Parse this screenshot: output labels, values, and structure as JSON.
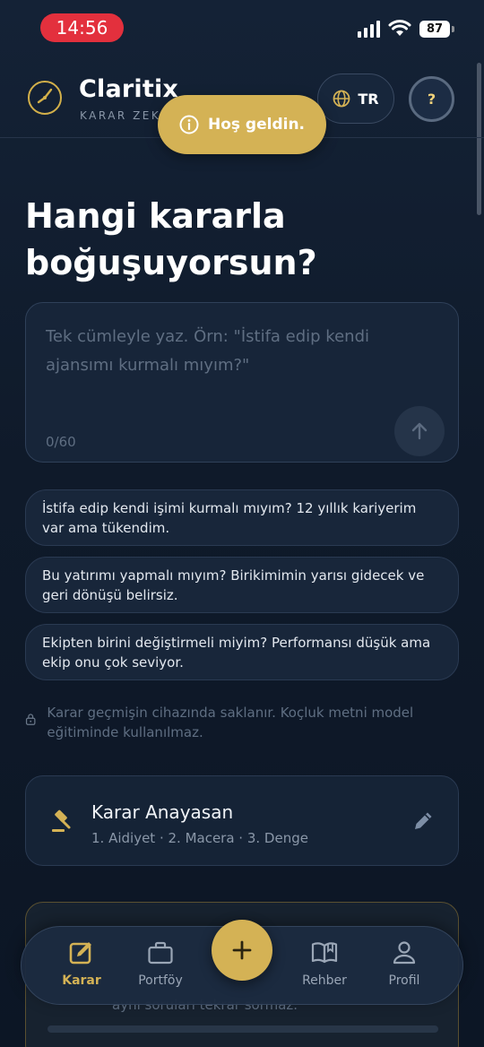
{
  "status_bar": {
    "time": "14:56",
    "battery": "87"
  },
  "header": {
    "app_name": "Claritix",
    "tagline": "KARAR ZEKÂ",
    "language": "TR",
    "help_label": "?"
  },
  "toast": {
    "message": "Hoş geldin."
  },
  "main": {
    "title_line1": "Hangi kararla",
    "title_line2": "boğuşuyorsun?",
    "input_placeholder": "Tek cümleyle yaz. Örn: \"İstifa edip kendi ajansımı kurmalı mıyım?\"",
    "input_value": "",
    "char_count": "0/60",
    "suggestions": [
      "İstifa edip kendi işimi kurmalı mıyım? 12 yıllık kariyerim var ama tükendim.",
      "Bu yatırımı yapmalı mıyım? Birikimimin yarısı gidecek ve geri dönüşü belirsiz.",
      "Ekipten birini değiştirmeli miyim? Performansı düşük ama ekip onu çok seviyor."
    ],
    "privacy_note": "Karar geçmişin cihazında saklanır. Koçluk metni model eğitiminde kullanılmaz."
  },
  "constitution": {
    "title": "Karar Anayasan",
    "values": "1. Aidiyet · 2. Macera · 3. Denge"
  },
  "partial_card": {
    "text": "aynı soruları tekrar sormaz."
  },
  "nav": {
    "items": [
      {
        "label": "Karar",
        "icon": "edit-square-icon",
        "active": true
      },
      {
        "label": "Portföy",
        "icon": "briefcase-icon",
        "active": false
      },
      {
        "label": "Rehber",
        "icon": "open-book-icon",
        "active": false
      },
      {
        "label": "Profil",
        "icon": "person-icon",
        "active": false
      }
    ],
    "fab_icon": "plus-icon"
  },
  "colors": {
    "background": "#0f1a2a",
    "accent_gold": "#d4b255",
    "card": "#18263a",
    "muted_text": "#5f6e82",
    "status_time_pill": "#e3303d"
  }
}
